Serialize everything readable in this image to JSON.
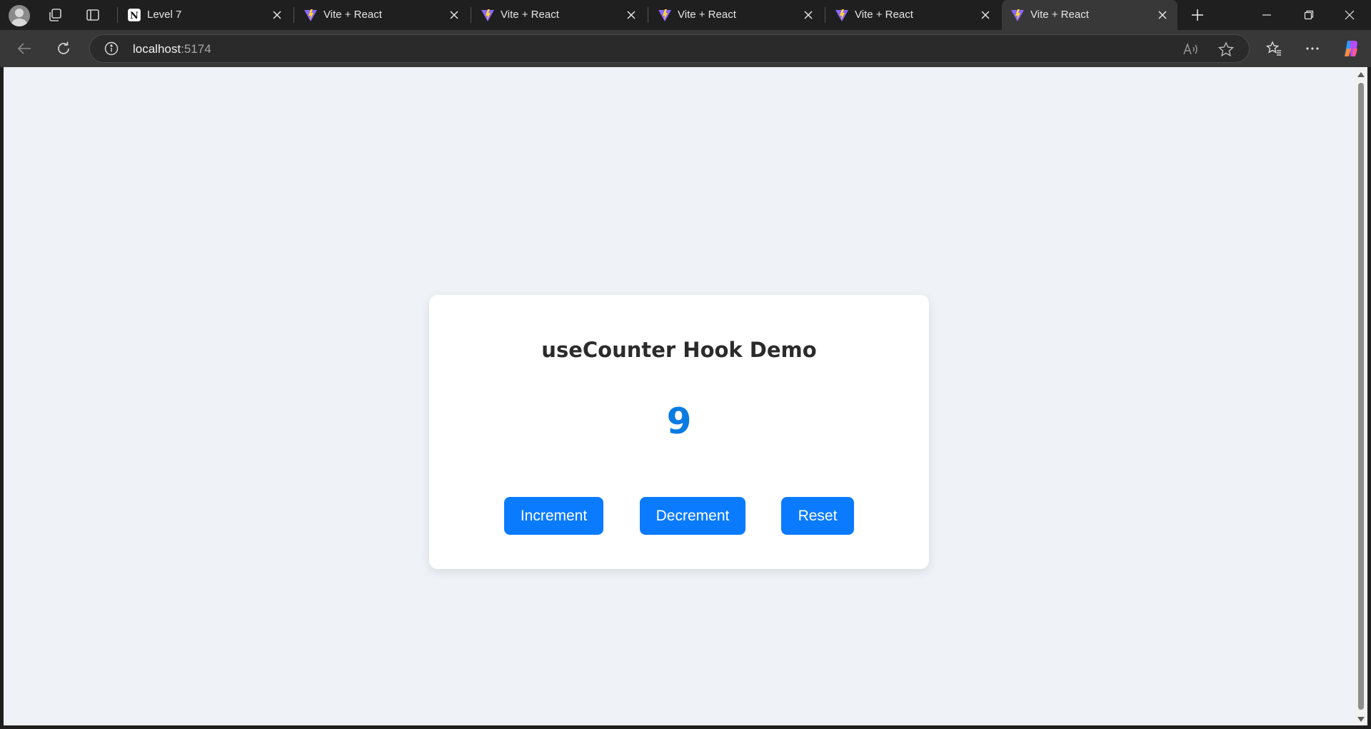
{
  "browser": {
    "tabs": [
      {
        "title": "Level 7",
        "favicon": "notion-icon",
        "active": false
      },
      {
        "title": "Vite + React",
        "favicon": "vite-icon",
        "active": false
      },
      {
        "title": "Vite + React",
        "favicon": "vite-icon",
        "active": false
      },
      {
        "title": "Vite + React",
        "favicon": "vite-icon",
        "active": false
      },
      {
        "title": "Vite + React",
        "favicon": "vite-icon",
        "active": false
      },
      {
        "title": "Vite + React",
        "favicon": "vite-icon",
        "active": true
      }
    ],
    "address": {
      "host": "localhost",
      "port": ":5174"
    }
  },
  "app": {
    "title": "useCounter Hook Demo",
    "count": "9",
    "buttons": {
      "increment": "Increment",
      "decrement": "Decrement",
      "reset": "Reset"
    }
  },
  "colors": {
    "accent": "#0a7bff",
    "counter": "#0b7be4",
    "page_background": "#eff3f8"
  }
}
